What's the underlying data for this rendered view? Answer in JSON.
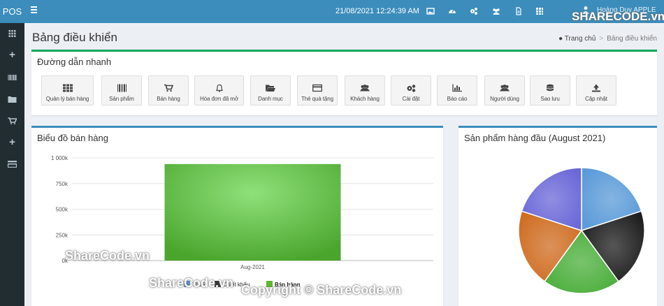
{
  "topbar": {
    "brand": "POS",
    "datetime": "21/08/2021 12:24:39 AM",
    "user_name": "Hoàng Duy APPLE"
  },
  "header": {
    "title": "Bảng điều khiển",
    "breadcrumb_home": "Trang chủ",
    "breadcrumb_current": "Bảng điều khiển"
  },
  "shortcuts": {
    "title": "Đường dẫn nhanh",
    "items": [
      {
        "label": "Quản lý bán hàng",
        "icon": "grid-icon"
      },
      {
        "label": "Sản phẩm",
        "icon": "barcode-icon"
      },
      {
        "label": "Bán hàng",
        "icon": "cart-icon"
      },
      {
        "label": "Hóa đơn đã mở",
        "icon": "bell-icon"
      },
      {
        "label": "Danh mục",
        "icon": "folder-open-icon"
      },
      {
        "label": "Thẻ quà tặng",
        "icon": "credit-card-icon"
      },
      {
        "label": "Khách hàng",
        "icon": "users-icon"
      },
      {
        "label": "Cài đặt",
        "icon": "cogs-icon"
      },
      {
        "label": "Báo cáo",
        "icon": "bar-chart-icon"
      },
      {
        "label": "Người dùng",
        "icon": "users-icon"
      },
      {
        "label": "Sao lưu",
        "icon": "database-icon"
      },
      {
        "label": "Cập nhật",
        "icon": "upload-icon"
      }
    ]
  },
  "sales_panel": {
    "title": "Biểu đồ bán hàng"
  },
  "top_products_panel": {
    "title": "Sản phẩm hàng đầu (August 2021)"
  },
  "chart_data": [
    {
      "type": "bar",
      "categories": [
        "Aug-2021"
      ],
      "series": [
        {
          "name": "Bán hàng",
          "values": [
            940000
          ],
          "color": "#5cb82e"
        }
      ],
      "yticks": [
        "0k",
        "250k",
        "500k",
        "750k",
        "1 000k"
      ],
      "ylim": [
        0,
        1000000
      ],
      "legend": [
        "Thuế",
        "Chiết khấu",
        "Bán hàng"
      ],
      "legend_placement": "bottom",
      "grid": true
    },
    {
      "type": "pie",
      "values": [
        20,
        20,
        20,
        20,
        20
      ],
      "colors": [
        "#5b9bd8",
        "#1e1e1e",
        "#4caf3c",
        "#cf6d22",
        "#6b68d8"
      ]
    }
  ],
  "colors": {
    "topbar": "#3c8dbc",
    "sidebar": "#222d32",
    "accent_green": "#00a65a",
    "accent_blue": "#3c8dbc"
  },
  "watermarks": {
    "logo_text": "SHARECODE.vn",
    "label1": "ShareCode.vn",
    "label2": "ShareCode.vn",
    "copyright": "Copyright © ShareCode.vn"
  }
}
